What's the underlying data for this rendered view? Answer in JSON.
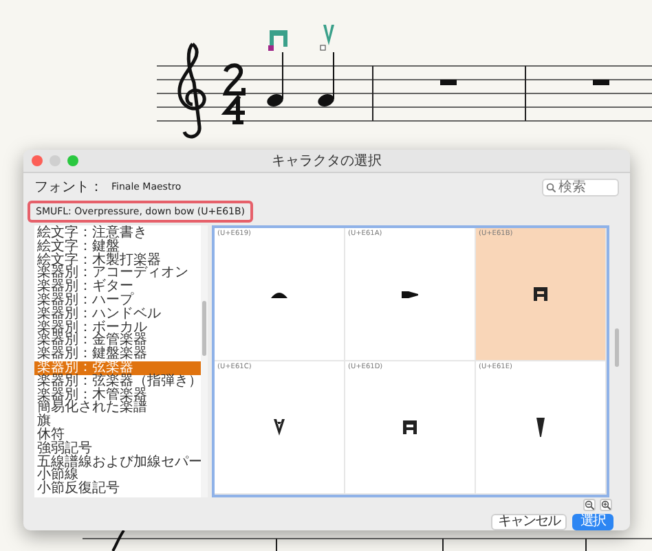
{
  "window": {
    "title": "キャラクタの選択"
  },
  "font": {
    "label": "フォント：",
    "value": "Finale Maestro"
  },
  "search": {
    "placeholder": "検索"
  },
  "smufl_name": "SMUFL: Overpressure, down bow (U+E61B)",
  "categories": [
    {
      "label": "絵文字：注意書き",
      "selected": false
    },
    {
      "label": "絵文字：鍵盤",
      "selected": false
    },
    {
      "label": "絵文字：木製打楽器",
      "selected": false
    },
    {
      "label": "楽器別：アコーディオン",
      "selected": false
    },
    {
      "label": "楽器別：ギター",
      "selected": false
    },
    {
      "label": "楽器別：ハープ",
      "selected": false
    },
    {
      "label": "楽器別：ハンドベル",
      "selected": false
    },
    {
      "label": "楽器別：ボーカル",
      "selected": false
    },
    {
      "label": "楽器別：金管楽器",
      "selected": false
    },
    {
      "label": "楽器別：鍵盤楽器",
      "selected": false
    },
    {
      "label": "楽器別：弦楽器",
      "selected": true
    },
    {
      "label": "楽器別：弦楽器（指弾き）",
      "selected": false
    },
    {
      "label": "楽器別：木管楽器",
      "selected": false
    },
    {
      "label": "簡易化された楽譜",
      "selected": false
    },
    {
      "label": "旗",
      "selected": false
    },
    {
      "label": "休符",
      "selected": false
    },
    {
      "label": "強弱記号",
      "selected": false
    },
    {
      "label": "五線譜線および加線セパー",
      "selected": false
    },
    {
      "label": "小節線",
      "selected": false
    },
    {
      "label": "小節反復記号",
      "selected": false
    }
  ],
  "glyphs": [
    {
      "code": "(U+E619)",
      "kind": "arc",
      "selected": false
    },
    {
      "code": "(U+E61A)",
      "kind": "dash",
      "selected": false
    },
    {
      "code": "(U+E61B)",
      "kind": "downbow",
      "selected": true
    },
    {
      "code": "(U+E61C)",
      "kind": "upbow",
      "selected": false
    },
    {
      "code": "(U+E61D)",
      "kind": "downbow",
      "selected": false
    },
    {
      "code": "(U+E61E)",
      "kind": "wedge",
      "selected": false
    }
  ],
  "buttons": [
    {
      "label": "キャンセル",
      "kind": "secondary"
    },
    {
      "label": "選択",
      "kind": "primary"
    }
  ]
}
